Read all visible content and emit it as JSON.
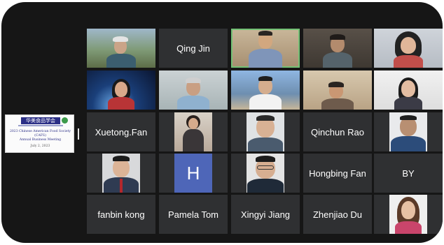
{
  "meeting": {
    "shared_content": {
      "logo_text": "华美食品学会",
      "title_lines": [
        "2023 Chinese American Food Society",
        "(CAFS)",
        "Annual Business Meeting"
      ],
      "date": "July 2, 2023"
    },
    "participants": [
      {
        "id": "p01",
        "kind": "video",
        "palette": "outdoor"
      },
      {
        "id": "p02",
        "kind": "name",
        "name": "Qing Jin"
      },
      {
        "id": "p03",
        "kind": "video",
        "palette": "home",
        "speaking": true
      },
      {
        "id": "p04",
        "kind": "video",
        "palette": "dim"
      },
      {
        "id": "p05",
        "kind": "video",
        "palette": "bright"
      },
      {
        "id": "p06",
        "kind": "video",
        "palette": "earth"
      },
      {
        "id": "p07",
        "kind": "video",
        "palette": "office"
      },
      {
        "id": "p08",
        "kind": "video",
        "palette": "city"
      },
      {
        "id": "p09",
        "kind": "video",
        "palette": "warm"
      },
      {
        "id": "p10",
        "kind": "video",
        "palette": "white"
      },
      {
        "id": "p11",
        "kind": "name",
        "name": "Xuetong.Fan"
      },
      {
        "id": "p12",
        "kind": "photo",
        "palette": "woman-stand"
      },
      {
        "id": "p13",
        "kind": "photo",
        "palette": "portrait"
      },
      {
        "id": "p14",
        "kind": "name",
        "name": "Qinchun Rao"
      },
      {
        "id": "p15",
        "kind": "photo",
        "palette": "portrait-dark"
      },
      {
        "id": "p16",
        "kind": "photo",
        "palette": "portrait-suit"
      },
      {
        "id": "p17",
        "kind": "initial",
        "initial": "H",
        "color": "#4e66b8"
      },
      {
        "id": "p18",
        "kind": "photo",
        "palette": "portrait-glasses"
      },
      {
        "id": "p19",
        "kind": "name",
        "name": "Hongbing Fan"
      },
      {
        "id": "p20",
        "kind": "name",
        "name": "BY"
      },
      {
        "id": "p21",
        "kind": "name",
        "name": "fanbin kong"
      },
      {
        "id": "p22",
        "kind": "name",
        "name": "Pamela Tom"
      },
      {
        "id": "p23",
        "kind": "name",
        "name": "Xingyi Jiang"
      },
      {
        "id": "p24",
        "kind": "name",
        "name": "Zhenjiao Du"
      },
      {
        "id": "p25",
        "kind": "photo",
        "palette": "woman-portrait"
      }
    ]
  },
  "colors": {
    "tile_bg": "#2f3032",
    "screen_bg": "#161616",
    "active_speaker": "#74c275",
    "avatar_blue": "#4e66b8"
  }
}
